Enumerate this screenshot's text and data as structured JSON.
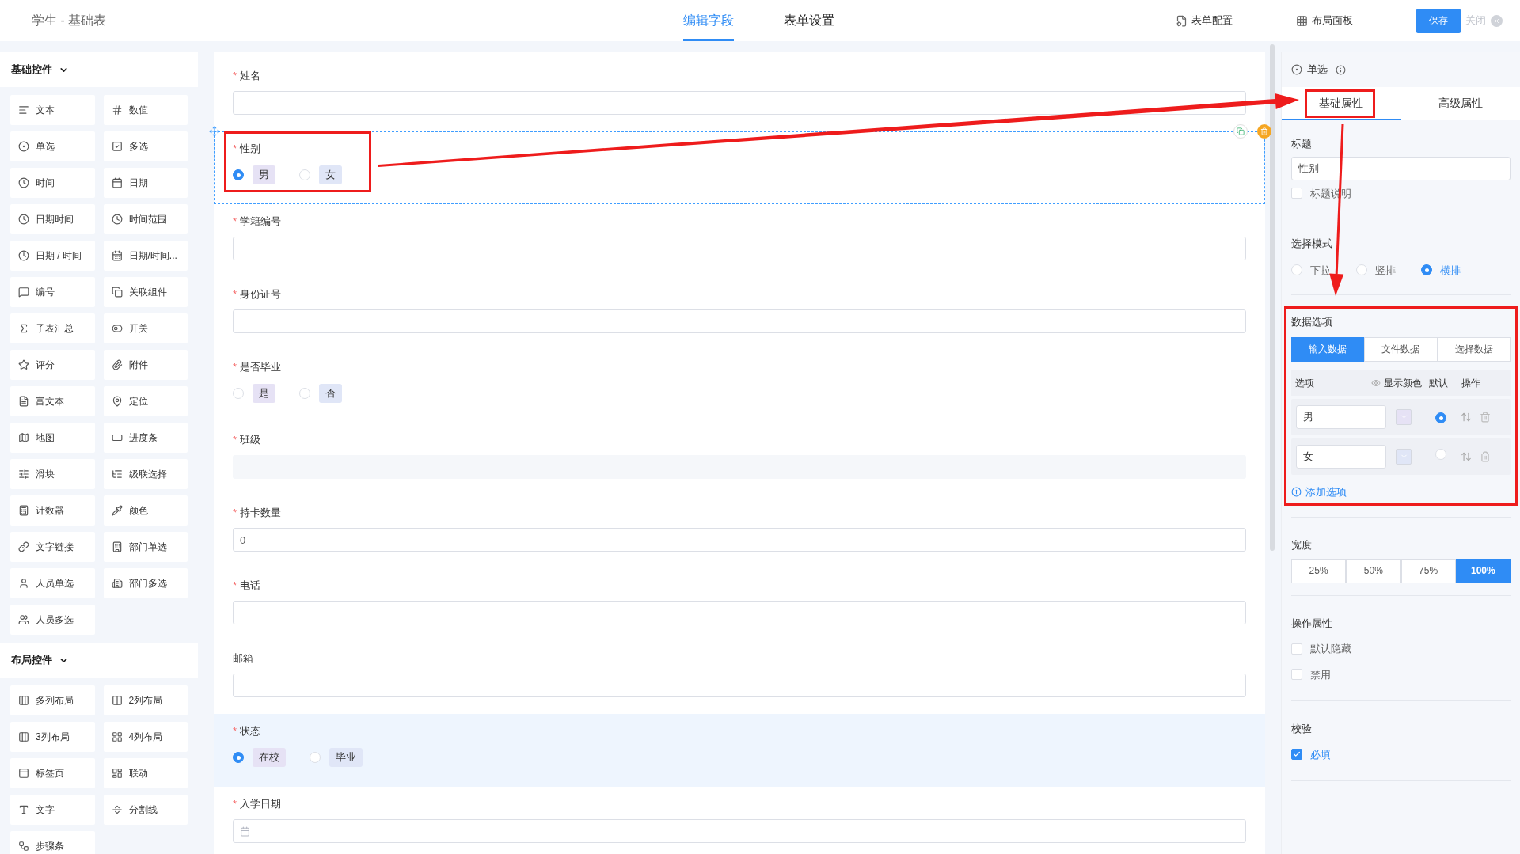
{
  "header": {
    "title": "学生 - 基础表",
    "tabs": [
      {
        "label": "编辑字段",
        "selected": true
      },
      {
        "label": "表单设置",
        "selected": false
      }
    ],
    "actions": [
      "表单配置",
      "布局面板"
    ],
    "save": "保存",
    "close": "关闭"
  },
  "sidebar": {
    "sections": [
      {
        "title": "基础控件",
        "expanded": true,
        "items": [
          "文本",
          "数值",
          "单选",
          "多选",
          "时间",
          "日期",
          "日期时间",
          "时间范围",
          "日期 / 时间",
          "日期/时间...",
          "编号",
          "关联组件",
          "子表汇总",
          "开关",
          "评分",
          "附件",
          "富文本",
          "定位",
          "地图",
          "进度条",
          "滑块",
          "级联选择",
          "计数器",
          "颜色",
          "文字链接",
          "部门单选",
          "人员单选",
          "部门多选",
          "人员多选"
        ]
      },
      {
        "title": "布局控件",
        "expanded": true,
        "items": [
          "多列布局",
          "2列布局",
          "3列布局",
          "4列布局",
          "标签页",
          "联动",
          "文字",
          "分割线",
          "步骤条"
        ]
      }
    ]
  },
  "form": {
    "fields": [
      {
        "label": "姓名",
        "required": "*",
        "kind": "input",
        "focused": false,
        "highlighted": false
      },
      {
        "label": "性别",
        "required": "*",
        "kind": "radio",
        "focused": true,
        "highlighted": false,
        "options": [
          {
            "label": "男",
            "selected": true,
            "color": "#e6e2f5"
          },
          {
            "label": "女",
            "selected": false,
            "color": "#e0e6f7"
          }
        ]
      },
      {
        "label": "学籍编号",
        "required": "*",
        "kind": "input",
        "focused": false,
        "highlighted": false
      },
      {
        "label": "身份证号",
        "required": "*",
        "kind": "input",
        "focused": false,
        "highlighted": false
      },
      {
        "label": "是否毕业",
        "required": "*",
        "kind": "radio",
        "focused": false,
        "highlighted": false,
        "options": [
          {
            "label": "是",
            "selected": false,
            "color": "#e6e2f5"
          },
          {
            "label": "否",
            "selected": false,
            "color": "#e0e6f7"
          }
        ]
      },
      {
        "label": "班级",
        "required": "*",
        "kind": "disabled",
        "focused": false,
        "highlighted": false
      },
      {
        "label": "持卡数量",
        "required": "*",
        "kind": "input",
        "value": "0",
        "focused": false,
        "highlighted": false
      },
      {
        "label": "电话",
        "required": "*",
        "kind": "input",
        "focused": false,
        "highlighted": false
      },
      {
        "label": "邮箱",
        "kind": "input",
        "focused": false,
        "highlighted": false
      },
      {
        "label": "状态",
        "required": "*",
        "kind": "radio",
        "focused": false,
        "highlighted": true,
        "options": [
          {
            "label": "在校",
            "selected": true,
            "color": "#e6e2f5"
          },
          {
            "label": "毕业",
            "selected": false,
            "color": "#e0e6f7"
          }
        ]
      },
      {
        "label": "入学日期",
        "required": "*",
        "kind": "date",
        "focused": false,
        "highlighted": false
      }
    ]
  },
  "panel": {
    "type": "单选",
    "tabs": [
      {
        "label": "基础属性",
        "selected": true
      },
      {
        "label": "高级属性",
        "selected": false
      }
    ],
    "title_label": "标题",
    "title_value": "性别",
    "title_desc": {
      "label": "标题说明",
      "checked": false
    },
    "mode_label": "选择模式",
    "modes": [
      {
        "label": "下拉",
        "selected": false
      },
      {
        "label": "竖排",
        "selected": false
      },
      {
        "label": "横排",
        "selected": true
      }
    ],
    "data_label": "数据选项",
    "sources": [
      {
        "label": "输入数据",
        "selected": true
      },
      {
        "label": "文件数据",
        "selected": false
      },
      {
        "label": "选择数据",
        "selected": false
      }
    ],
    "columns": [
      "选项",
      "显示颜色",
      "默认",
      "操作"
    ],
    "options": [
      {
        "value": "男",
        "color": "#e6e2f5",
        "default": true
      },
      {
        "value": "女",
        "color": "#e0e6f7",
        "default": false
      }
    ],
    "add_option": "添加选项",
    "width_label": "宽度",
    "widths": [
      {
        "label": "25%",
        "selected": false
      },
      {
        "label": "50%",
        "selected": false
      },
      {
        "label": "75%",
        "selected": false
      },
      {
        "label": "100%",
        "selected": true
      }
    ],
    "ops_label": "操作属性",
    "ops": [
      {
        "label": "默认隐藏",
        "checked": false
      },
      {
        "label": "禁用",
        "checked": false
      }
    ],
    "check_label": "校验",
    "checks": [
      {
        "label": "必填",
        "checked": true
      }
    ]
  }
}
